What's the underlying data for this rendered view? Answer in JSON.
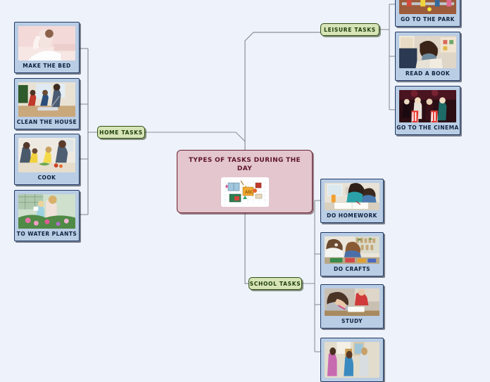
{
  "diagram": {
    "type": "mind-map",
    "background_color": "#eef2fa",
    "central": {
      "title": "TYPES OF TASKS DURING THE DAY",
      "fill_color": "#e3c6ce",
      "border_color": "#6b2233",
      "image_name": "school-supplies-collage-thumbnail"
    },
    "branches": [
      {
        "label": "HOME TASKS",
        "fill_color": "#d6e4b6",
        "border_color": "#2d4f13",
        "side": "left",
        "children": [
          {
            "label": "MAKE THE BED",
            "image_name": "making-bed-photo-thumbnail"
          },
          {
            "label": "CLEAN THE HOUSE",
            "image_name": "family-vacuuming-photo-thumbnail"
          },
          {
            "label": "COOK",
            "image_name": "family-cooking-photo-thumbnail"
          },
          {
            "label": "TO WATER PLANTS",
            "image_name": "watering-plants-photo-thumbnail"
          }
        ]
      },
      {
        "label": "LEISURE TASKS",
        "fill_color": "#d6e4b6",
        "border_color": "#2d4f13",
        "side": "right-top",
        "children": [
          {
            "label": "GO TO THE PARK",
            "image_name": "children-park-photo-thumbnail"
          },
          {
            "label": "READ A BOOK",
            "image_name": "boy-reading-book-photo-thumbnail"
          },
          {
            "label": "GO TO THE CINEMA",
            "image_name": "cinema-audience-photo-thumbnail"
          }
        ]
      },
      {
        "label": "SCHOOL TASKS",
        "fill_color": "#d6e4b6",
        "border_color": "#2d4f13",
        "side": "right-bottom",
        "children": [
          {
            "label": "DO HOMEWORK",
            "image_name": "homework-help-photo-thumbnail"
          },
          {
            "label": "DO CRAFTS",
            "image_name": "crafts-table-photo-thumbnail"
          },
          {
            "label": "STUDY",
            "image_name": "boy-studying-photo-thumbnail"
          },
          {
            "label": "",
            "image_name": "classroom-children-photo-thumbnail"
          }
        ]
      }
    ],
    "leaf_style": {
      "fill_color": "#b9cde4",
      "border_color": "#1f3864"
    }
  }
}
